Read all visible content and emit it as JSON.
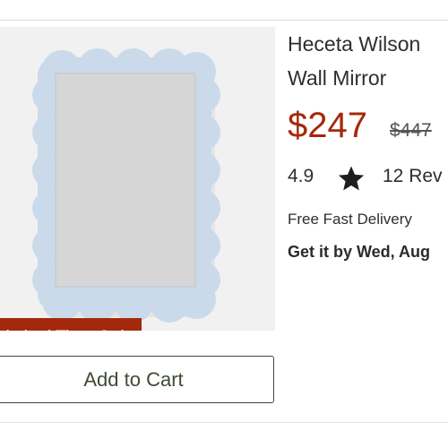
{
  "product": {
    "title_line_1": "Heceta Wilson",
    "title_line_2": "Wall Mirror",
    "price_current": "$247",
    "price_original": "$447",
    "rating": "4.9",
    "reviews": "12 Rev",
    "delivery_label": "Free Fast Delivery",
    "delivery_date": "Get it by Wed, Aug",
    "promo_badge": "Limited Time Only"
  },
  "actions": {
    "add_to_cart_label": "Add to Cart"
  },
  "icons": {
    "rating_star": "star-icon"
  },
  "colors": {
    "price_accent": "#a4290c",
    "badge_background": "#a4290c",
    "button_border": "#3f4a33",
    "mirror_frame": "#cbdaea"
  }
}
